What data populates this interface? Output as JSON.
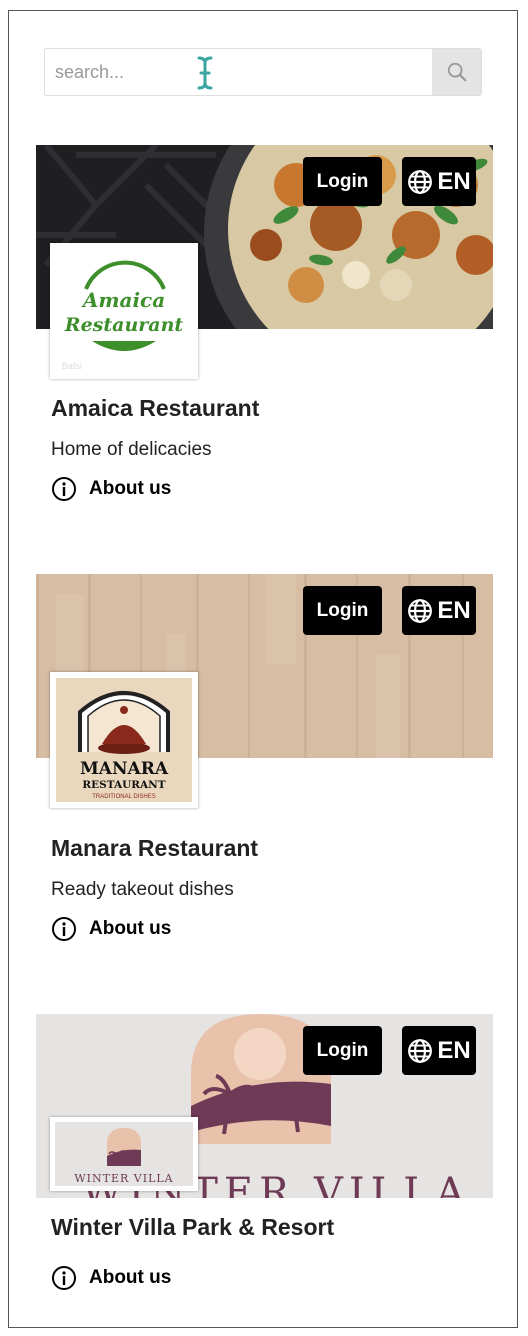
{
  "search": {
    "placeholder": "search...",
    "value": ""
  },
  "header_buttons": {
    "login_label": "Login",
    "lang_label": "EN"
  },
  "restaurants": [
    {
      "name": "Amaica Restaurant",
      "tagline": "Home of delicacies",
      "about_label": "About us",
      "logo_text": [
        "Amaica",
        "Restaurant"
      ],
      "logo_caption": "Bafsi"
    },
    {
      "name": "Manara Restaurant",
      "tagline": "Ready takeout dishes",
      "about_label": "About us",
      "logo_text": [
        "MANARA",
        "RESTAURANT",
        "TRADITIONAL DISHES"
      ]
    },
    {
      "name": "Winter Villa Park & Resort",
      "tagline": "",
      "about_label": "About us",
      "logo_text": [
        "WINTER VILLA"
      ],
      "banner_text": "WINTER VILLA"
    }
  ],
  "colors": {
    "logo_green": "#3c8f2a",
    "manara_red": "#8a2a1c",
    "villa_plum": "#6e3a55",
    "villa_sand": "#e9c2ac",
    "wood": "#d6bda4"
  },
  "icons": [
    "search-icon",
    "globe-icon",
    "info-icon",
    "text-cursor-icon"
  ]
}
